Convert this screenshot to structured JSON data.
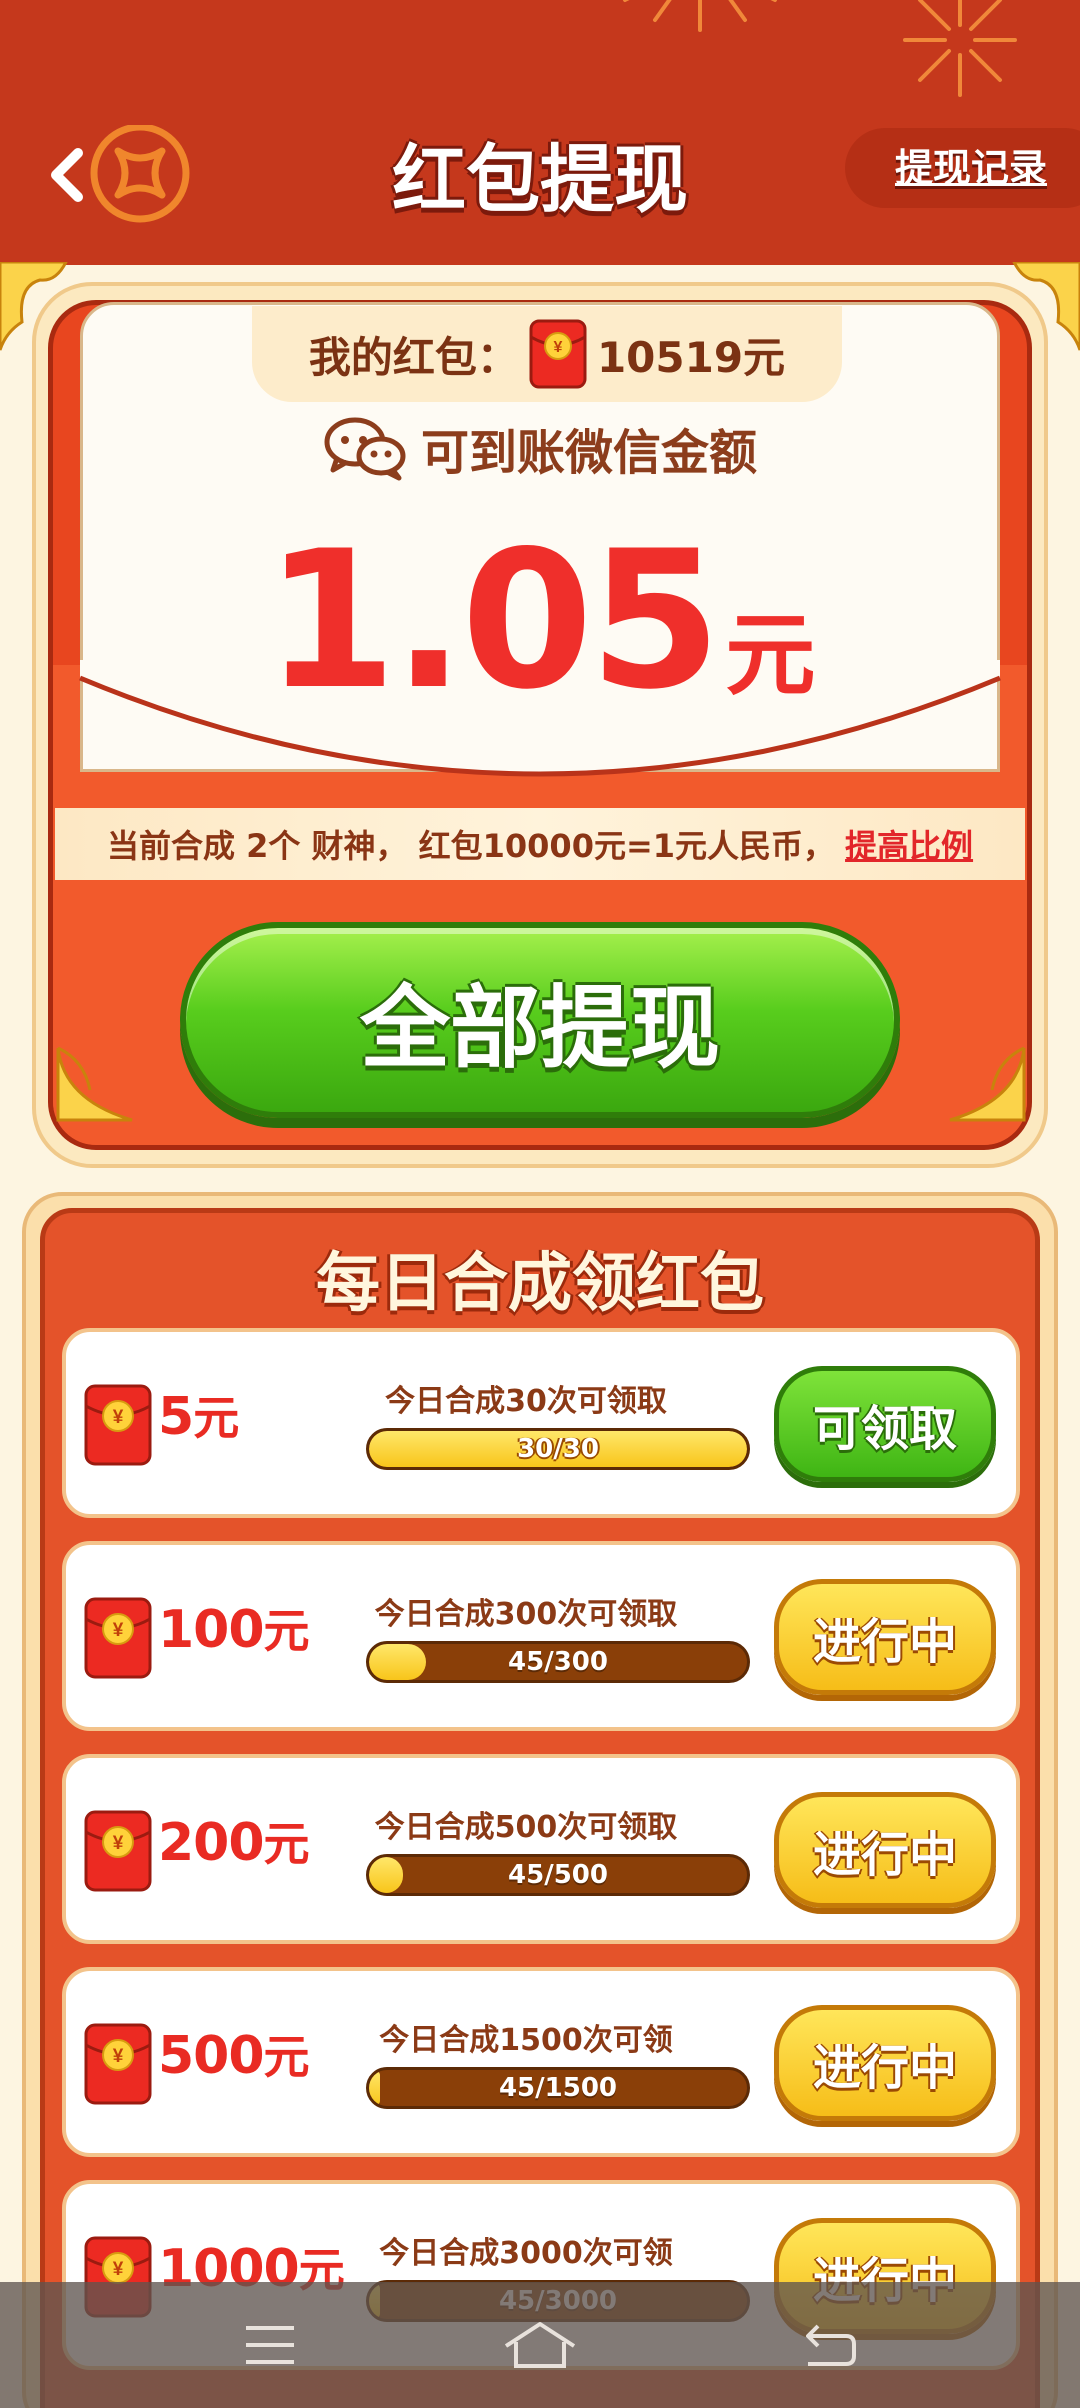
{
  "header": {
    "title": "红包提现",
    "record_label": "提现记录"
  },
  "balance": {
    "label": "我的红包：",
    "value": "10519元"
  },
  "wechat": {
    "label": "可到账微信金额",
    "amount": "1.05",
    "unit": "元"
  },
  "rate": {
    "text": "当前合成 2个 财神， 红包10000元=1元人民币，",
    "link": "提高比例"
  },
  "withdraw_all_label": "全部提现",
  "daily": {
    "title": "每日合成领红包",
    "tasks": [
      {
        "amount": "5",
        "unit": "元",
        "desc": "今日合成30次可领取",
        "progress": "30/30",
        "fraction": 1.0,
        "action": "可领取",
        "state": "claim"
      },
      {
        "amount": "100",
        "unit": "元",
        "desc": "今日合成300次可领取",
        "progress": "45/300",
        "fraction": 0.15,
        "action": "进行中",
        "state": "progress"
      },
      {
        "amount": "200",
        "unit": "元",
        "desc": "今日合成500次可领取",
        "progress": "45/500",
        "fraction": 0.09,
        "action": "进行中",
        "state": "progress"
      },
      {
        "amount": "500",
        "unit": "元",
        "desc": "今日合成1500次可领取",
        "progress": "45/1500",
        "fraction": 0.03,
        "action": "进行中",
        "state": "progress"
      },
      {
        "amount": "1000",
        "unit": "元",
        "desc": "今日合成3000次可领取",
        "progress": "45/3000",
        "fraction": 0.015,
        "action": "进行中",
        "state": "progress"
      }
    ]
  },
  "icons": {
    "back": "chevron-left-icon",
    "coin": "coin-icon",
    "wechat": "wechat-icon",
    "red_envelope": "red-envelope-icon",
    "nav_menu": "menu-icon",
    "nav_home": "home-icon",
    "nav_back": "back-icon"
  },
  "colors": {
    "header_bg": "#c5381c",
    "accent_red": "#ef2f2b",
    "green_button": "#58cd1d",
    "yellow_button": "#f8c51a"
  }
}
